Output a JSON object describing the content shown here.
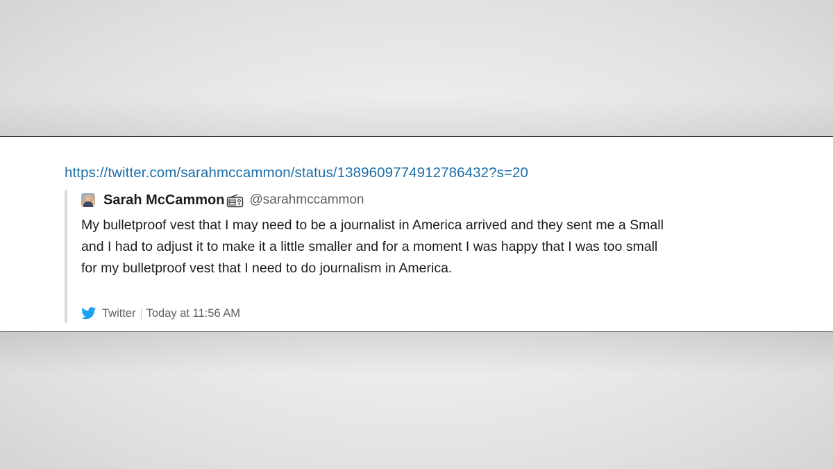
{
  "link": {
    "url": "https://twitter.com/sarahmccammon/status/1389609774912786432?s=20"
  },
  "tweet": {
    "author_name": "Sarah McCammon",
    "author_emoji_icon": "radio-icon",
    "handle": "@sarahmccammon",
    "text": "My bulletproof vest that I may need to be a journalist in America arrived and they sent me a Small and I had to adjust it to make it a little smaller and for a moment I was happy that I was too small for my bulletproof vest that I need to do journalism in America.",
    "source": "Twitter",
    "timestamp": "Today at 11:56 AM"
  },
  "colors": {
    "link": "#1d6fa8",
    "twitter_blue": "#1da1f2",
    "text": "#1d1c1d",
    "muted": "#616061"
  }
}
